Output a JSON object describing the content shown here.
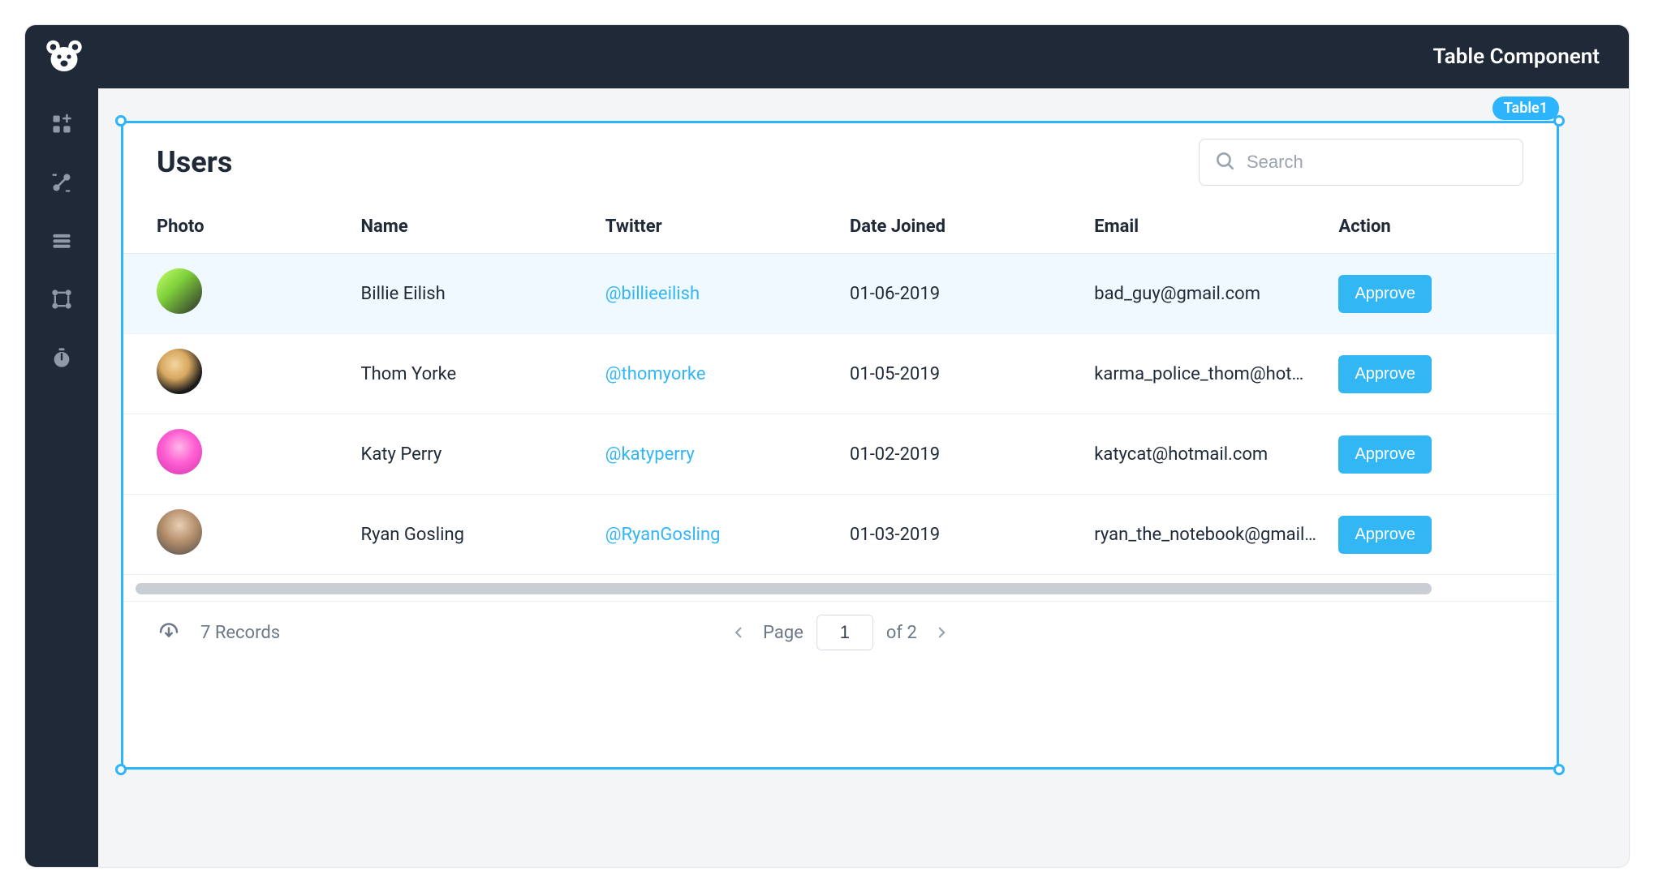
{
  "header": {
    "title": "Table Component"
  },
  "selection": {
    "tag": "Table1"
  },
  "toolbar": {
    "icons": [
      "widgets",
      "connect",
      "list",
      "nodes",
      "timer"
    ]
  },
  "table": {
    "title": "Users",
    "search_placeholder": "Search",
    "columns": [
      "Photo",
      "Name",
      "Twitter",
      "Date Joined",
      "Email",
      "Action"
    ],
    "action_label": "Approve",
    "rows": [
      {
        "name": "Billie Eilish",
        "twitter": "@billieeilish",
        "date_joined": "01-06-2019",
        "email": "bad_guy@gmail.com",
        "avatar_bg": "linear-gradient(135deg,#c6ff6b 0%,#7fd13b 40%,#2b2b2b 100%)",
        "highlight": true
      },
      {
        "name": "Thom Yorke",
        "twitter": "@thomyorke",
        "date_joined": "01-05-2019",
        "email": "karma_police_thom@hotmail.com",
        "avatar_bg": "radial-gradient(circle at 40% 35%, #f3d6a0 0%, #d8a860 35%, #1a1a1a 70%)",
        "highlight": false
      },
      {
        "name": "Katy Perry",
        "twitter": "@katyperry",
        "date_joined": "01-02-2019",
        "email": "katycat@hotmail.com",
        "avatar_bg": "radial-gradient(circle at 50% 40%, #ffb8e8 0%, #ff5fd2 45%, #d133b0 100%)",
        "highlight": false
      },
      {
        "name": "Ryan Gosling",
        "twitter": "@RyanGosling",
        "date_joined": "01-03-2019",
        "email": "ryan_the_notebook@gmail.com",
        "avatar_bg": "radial-gradient(circle at 50% 35%, #e9cfb5 0%, #b58f6c 45%, #4a4a4a 100%)",
        "highlight": false
      }
    ]
  },
  "footer": {
    "records_label": "7 Records",
    "page_label": "Page",
    "page_current": "1",
    "page_of_label": "of 2"
  }
}
